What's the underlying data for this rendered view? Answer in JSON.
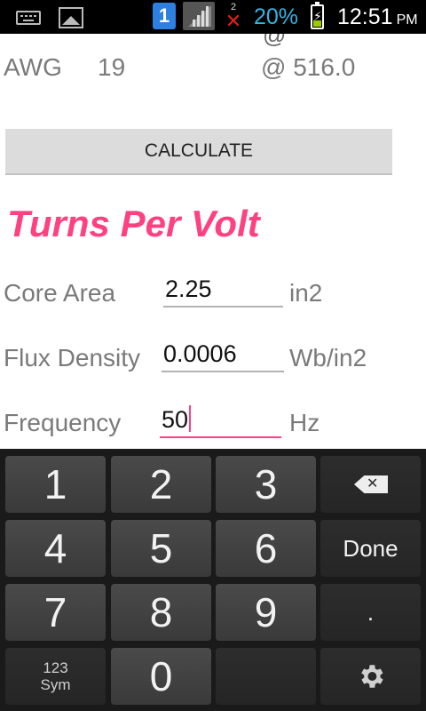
{
  "status_bar": {
    "sim_slot": "1",
    "notification_count": "2",
    "battery_percent": "20%",
    "time": "12:51",
    "ampm": "PM",
    "battery_level": 0.2,
    "accent_color": "#33b5e5"
  },
  "awg_row": {
    "cut_top_char": "@",
    "label": "AWG",
    "value": "19",
    "current_text": "@ 516.0"
  },
  "calculate_button": {
    "label": "CALCULATE"
  },
  "turns_per_volt": {
    "title": "Turns Per Volt",
    "title_color": "#ff4081",
    "fields": [
      {
        "label": "Core Area",
        "value": "2.25",
        "unit": "in2"
      },
      {
        "label": "Flux Density",
        "value": "0.0006",
        "unit": "Wb/in2"
      },
      {
        "label": "Frequency",
        "value": "50",
        "unit": "Hz"
      }
    ]
  },
  "keyboard": {
    "keys": [
      [
        "1",
        "2",
        "3",
        "backspace-icon"
      ],
      [
        "4",
        "5",
        "6",
        "Done"
      ],
      [
        "7",
        "8",
        "9",
        "."
      ],
      [
        "123",
        "0",
        "",
        "gear-icon"
      ]
    ],
    "sym_label_line1": "123",
    "sym_label_line2": "Sym",
    "done_label": "Done",
    "dot_label": "."
  }
}
